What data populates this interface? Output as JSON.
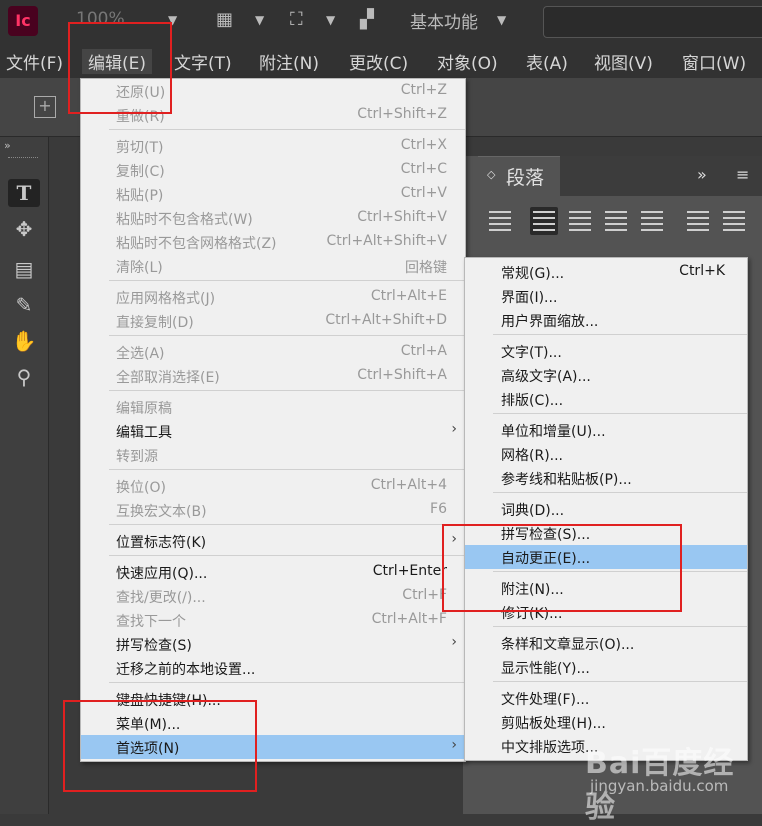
{
  "app": {
    "logo": "Ic",
    "zoom": "100%",
    "workspace": "基本功能",
    "caret": "⌄"
  },
  "menubar": [
    "文件(F)",
    "编辑(E)",
    "文字(T)",
    "附注(N)",
    "更改(C)",
    "对象(O)",
    "表(A)",
    "视图(V)",
    "窗口(W)"
  ],
  "panel": {
    "title": "段落",
    "more": "»",
    "menu": "≡"
  },
  "edit_menu": {
    "items": [
      {
        "label": "还原(U)",
        "shortcut": "Ctrl+Z",
        "enabled": false
      },
      {
        "label": "重做(R)",
        "shortcut": "Ctrl+Shift+Z",
        "enabled": false
      },
      {
        "label": "剪切(T)",
        "shortcut": "Ctrl+X",
        "enabled": false
      },
      {
        "label": "复制(C)",
        "shortcut": "Ctrl+C",
        "enabled": false
      },
      {
        "label": "粘贴(P)",
        "shortcut": "Ctrl+V",
        "enabled": false
      },
      {
        "label": "粘贴时不包含格式(W)",
        "shortcut": "Ctrl+Shift+V",
        "enabled": false
      },
      {
        "label": "粘贴时不包含网格格式(Z)",
        "shortcut": "Ctrl+Alt+Shift+V",
        "enabled": false
      },
      {
        "label": "清除(L)",
        "shortcut": "回格键",
        "enabled": false
      },
      {
        "label": "应用网格格式(J)",
        "shortcut": "Ctrl+Alt+E",
        "enabled": false
      },
      {
        "label": "直接复制(D)",
        "shortcut": "Ctrl+Alt+Shift+D",
        "enabled": false
      },
      {
        "label": "全选(A)",
        "shortcut": "Ctrl+A",
        "enabled": false
      },
      {
        "label": "全部取消选择(E)",
        "shortcut": "Ctrl+Shift+A",
        "enabled": false
      },
      {
        "label": "编辑原稿",
        "shortcut": "",
        "enabled": false
      },
      {
        "label": "编辑工具",
        "shortcut": "",
        "enabled": true,
        "submenu": true
      },
      {
        "label": "转到源",
        "shortcut": "",
        "enabled": false
      },
      {
        "label": "换位(O)",
        "shortcut": "Ctrl+Alt+4",
        "enabled": false
      },
      {
        "label": "互换宏文本(B)",
        "shortcut": "F6",
        "enabled": false
      },
      {
        "label": "位置标志符(K)",
        "shortcut": "",
        "enabled": true,
        "submenu": true
      },
      {
        "label": "快速应用(Q)...",
        "shortcut": "Ctrl+Enter",
        "enabled": true
      },
      {
        "label": "查找/更改(/)...",
        "shortcut": "Ctrl+F",
        "enabled": false
      },
      {
        "label": "查找下一个",
        "shortcut": "Ctrl+Alt+F",
        "enabled": false
      },
      {
        "label": "拼写检查(S)",
        "shortcut": "",
        "enabled": true,
        "submenu": true
      },
      {
        "label": "迁移之前的本地设置...",
        "shortcut": "",
        "enabled": true
      },
      {
        "label": "键盘快捷键(H)...",
        "shortcut": "",
        "enabled": true
      },
      {
        "label": "菜单(M)...",
        "shortcut": "",
        "enabled": true
      },
      {
        "label": "首选项(N)",
        "shortcut": "",
        "enabled": true,
        "submenu": true,
        "highlighted": true
      }
    ],
    "arrow": "›"
  },
  "prefs_submenu": {
    "items": [
      {
        "label": "常规(G)...",
        "shortcut": "Ctrl+K"
      },
      {
        "label": "界面(I)...",
        "shortcut": ""
      },
      {
        "label": "用户界面缩放...",
        "shortcut": ""
      },
      {
        "label": "文字(T)...",
        "shortcut": ""
      },
      {
        "label": "高级文字(A)...",
        "shortcut": ""
      },
      {
        "label": "排版(C)...",
        "shortcut": ""
      },
      {
        "label": "单位和增量(U)...",
        "shortcut": ""
      },
      {
        "label": "网格(R)...",
        "shortcut": ""
      },
      {
        "label": "参考线和粘贴板(P)...",
        "shortcut": ""
      },
      {
        "label": "词典(D)...",
        "shortcut": ""
      },
      {
        "label": "拼写检查(S)...",
        "shortcut": ""
      },
      {
        "label": "自动更正(E)...",
        "shortcut": "",
        "highlighted": true
      },
      {
        "label": "附注(N)...",
        "shortcut": ""
      },
      {
        "label": "修订(K)...",
        "shortcut": ""
      },
      {
        "label": "条样和文章显示(O)...",
        "shortcut": ""
      },
      {
        "label": "显示性能(Y)...",
        "shortcut": ""
      },
      {
        "label": "文件处理(F)...",
        "shortcut": ""
      },
      {
        "label": "剪贴板处理(H)...",
        "shortcut": ""
      },
      {
        "label": "中文排版选项...",
        "shortcut": ""
      }
    ]
  },
  "watermark": {
    "brand": "Bai百度经验",
    "url": "jingyan.baidu.com"
  },
  "colors": {
    "highlight": "#99c7f2",
    "annotation": "#e02020",
    "menu_bg": "#f0f0f0"
  }
}
